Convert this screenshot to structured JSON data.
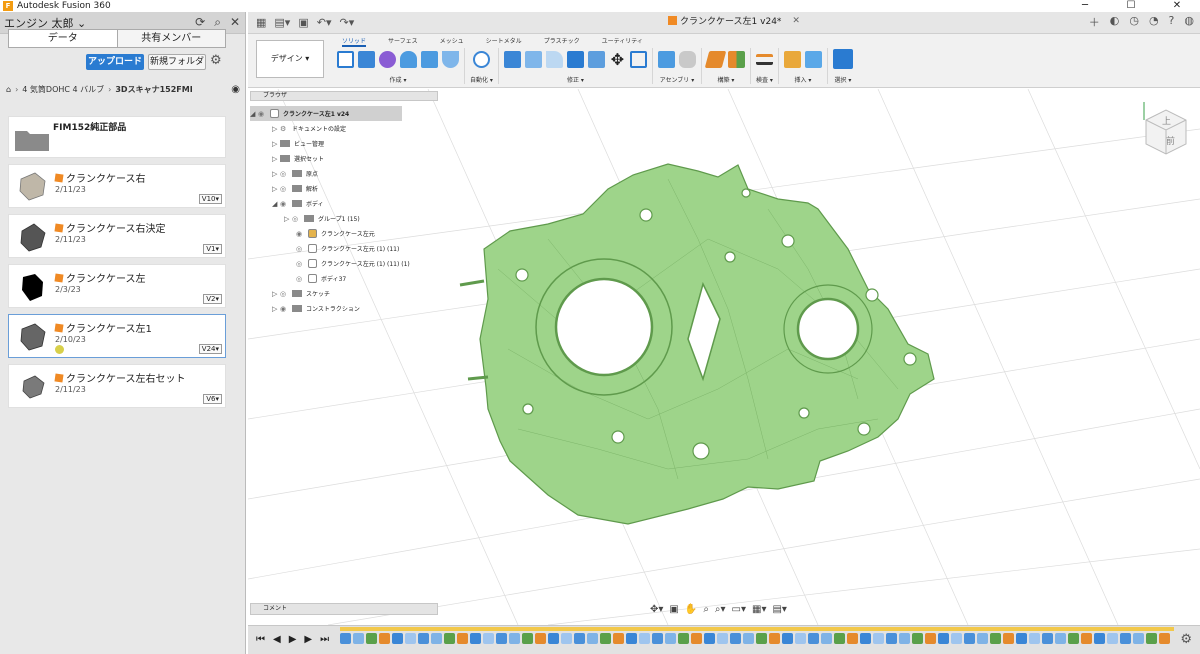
{
  "titlebar": {
    "app_title": "Autodesk Fusion 360",
    "minimize": "─",
    "maximize": "☐",
    "close": "✕"
  },
  "data_panel": {
    "user": "エンジン 太郎 ⌄",
    "tab_data": "データ",
    "tab_shared": "共有メンバー",
    "upload": "アップロード",
    "new_folder": "新規フォルダ",
    "breadcrumb": [
      "4 気筒DOHC 4 バルブ",
      "3Dスキャナ152FMI"
    ],
    "folder": {
      "name": "FIM152純正部品"
    },
    "files": [
      {
        "name": "クランクケース右",
        "date": "2/11/23",
        "version": "V10▾"
      },
      {
        "name": "クランクケース右決定",
        "date": "2/11/23",
        "version": "V1▾"
      },
      {
        "name": "クランクケース左",
        "date": "2/3/23",
        "version": "V2▾"
      },
      {
        "name": "クランクケース左1",
        "date": "2/10/23",
        "version": "V24▾"
      },
      {
        "name": "クランクケース左右セット",
        "date": "2/11/23",
        "version": "V6▾"
      }
    ]
  },
  "doc_tab": {
    "title": "クランクケース左1 v24*",
    "close": "✕"
  },
  "ribbon": {
    "workspace": "デザイン ▾",
    "tabs": [
      "ソリッド",
      "サーフェス",
      "メッシュ",
      "シートメタル",
      "プラスチック",
      "ユーティリティ"
    ],
    "groups": [
      "作成 ▾",
      "自動化 ▾",
      "修正 ▾",
      "アセンブリ ▾",
      "構築 ▾",
      "検査 ▾",
      "挿入 ▾",
      "選択 ▾"
    ]
  },
  "browser": {
    "title": "ブラウザ",
    "root": "クランクケース左1 v24",
    "items": [
      "ドキュメントの設定",
      "ビュー管理",
      "選択セット",
      "原点",
      "解析",
      "ボディ",
      "グループ1 (15)",
      "クランクケース左元",
      "クランクケース左元 (1) (11)",
      "クランクケース左元 (1) (11) (1)",
      "ボディ37",
      "スケッチ",
      "コンストラクション"
    ]
  },
  "comment": "コメント",
  "viewcube": {
    "top": "上",
    "front": "前"
  },
  "colors": {
    "mesh_fill": "#9ed48a",
    "mesh_line": "#5f9a4c",
    "accent": "#2a7bd1",
    "timeline_bar": "#f2c84b"
  }
}
